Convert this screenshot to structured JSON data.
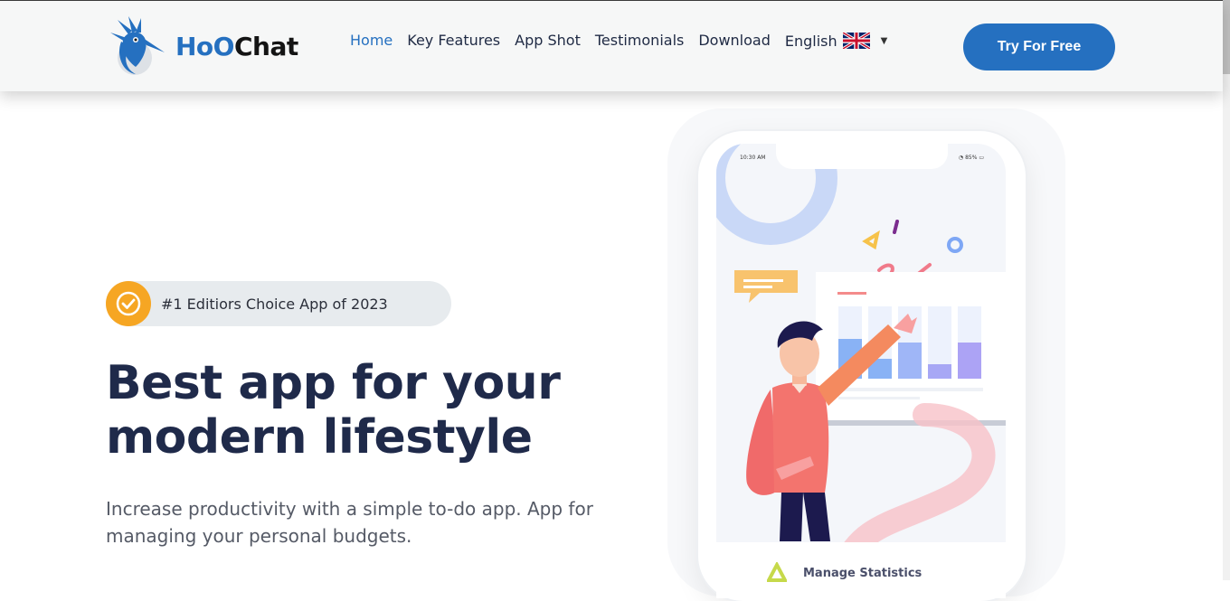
{
  "header": {
    "logo": {
      "part1": "HoO",
      "part2": "Chat"
    },
    "nav": [
      {
        "label": "Home",
        "active": true
      },
      {
        "label": "Key Features",
        "active": false
      },
      {
        "label": "App Shot",
        "active": false
      },
      {
        "label": "Testimonials",
        "active": false
      },
      {
        "label": "Download",
        "active": false
      }
    ],
    "language": {
      "label": "English"
    },
    "cta": {
      "label": "Try For Free"
    }
  },
  "hero": {
    "badge": "#1 Editiors Choice App of 2023",
    "title_line1": "Best app for your",
    "title_line2": "modern lifestyle",
    "subtitle": "Increase productivity with a simple to-do app. App for managing your personal budgets."
  },
  "phone": {
    "status_time": "10:30 AM",
    "status_battery": "85%",
    "caption": "Manage Statistics",
    "chart_data": {
      "type": "bar",
      "categories": [
        "",
        "",
        "",
        "",
        "",
        ""
      ],
      "values": [
        40,
        22,
        38,
        16,
        40,
        0
      ]
    }
  },
  "colors": {
    "brand_blue": "#2570c0",
    "heading": "#1f2a4a",
    "badge_orange": "#f6a623"
  }
}
